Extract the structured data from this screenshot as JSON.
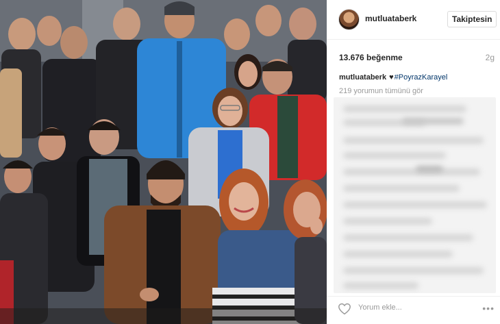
{
  "post": {
    "photo_icon": "group-photo-image"
  },
  "header": {
    "username": "mutluataberk",
    "follow_label": "Takiptesin",
    "avatar_icon": "profile-avatar"
  },
  "stats": {
    "likes": "13.676 beğenme",
    "age": "2g"
  },
  "caption": {
    "username": "mutluataberk",
    "heart": "♥",
    "hashtag": "#PoyrazKarayel"
  },
  "comments": {
    "view_all": "219 yorumun tümünü gör",
    "blurred": true
  },
  "footer": {
    "like_icon": "heart-outline-icon",
    "comment_placeholder": "Yorum ekle...",
    "more_icon": "more-options-icon",
    "more_glyph": "•••"
  },
  "colors": {
    "hashtag": "#003569",
    "muted": "#999999",
    "border": "#dbdbdb"
  }
}
